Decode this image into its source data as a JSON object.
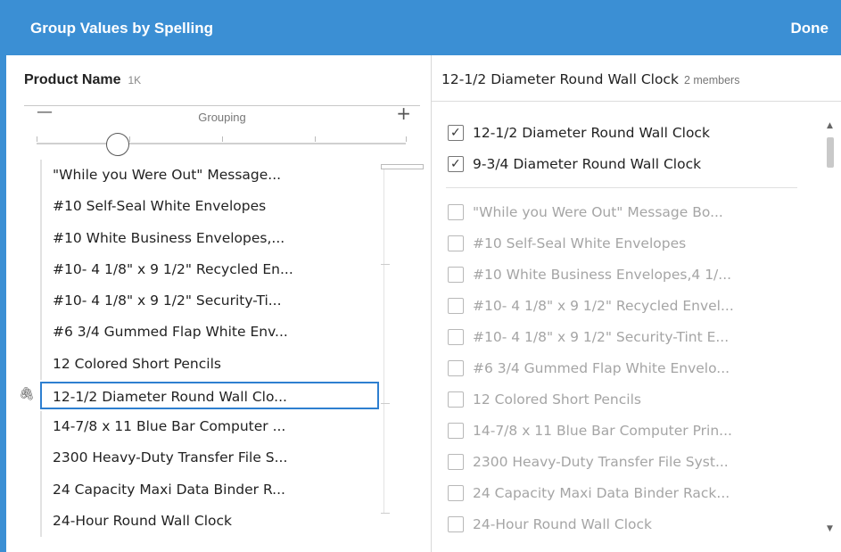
{
  "header": {
    "title": "Group Values by Spelling",
    "done_label": "Done"
  },
  "left": {
    "field_name": "Product Name",
    "field_count": "1K",
    "slider": {
      "label": "Grouping",
      "minus": "—",
      "plus": "+",
      "level": 0.22
    },
    "values": [
      "\"While you Were Out\" Message...",
      "#10 Self-Seal White Envelopes",
      "#10 White Business Envelopes,...",
      "#10- 4 1/8\" x 9 1/2\" Recycled En...",
      "#10- 4 1/8\" x 9 1/2\" Security-Ti...",
      "#6 3/4 Gummed Flap White Env...",
      "12 Colored Short Pencils",
      "12-1/2 Diameter Round Wall Clo...",
      "14-7/8 x 11 Blue Bar Computer ...",
      "2300 Heavy-Duty Transfer File S...",
      "24 Capacity Maxi Data Binder R...",
      "24-Hour Round Wall Clock"
    ],
    "selected_index": 7
  },
  "right": {
    "group_name": "12-1/2 Diameter Round Wall Clock",
    "members_label": "2 members",
    "checked_members": [
      "12-1/2 Diameter Round Wall Clock",
      "9-3/4 Diameter Round Wall Clock"
    ],
    "other_values": [
      "\"While you Were Out\" Message Bo...",
      "#10 Self-Seal White Envelopes",
      "#10 White Business Envelopes,4 1/...",
      "#10- 4 1/8\" x 9 1/2\" Recycled Envel...",
      "#10- 4 1/8\" x 9 1/2\" Security-Tint E...",
      "#6 3/4 Gummed Flap White Envelo...",
      "12 Colored Short Pencils",
      "14-7/8 x 11 Blue Bar Computer Prin...",
      "2300 Heavy-Duty Transfer File Syst...",
      "24 Capacity Maxi Data Binder Rack...",
      "24-Hour Round Wall Clock"
    ]
  },
  "colors": {
    "header": "#3b8fd4",
    "selection": "#2e7fd0"
  },
  "icons": {
    "group": "paperclip-icon",
    "checkbox_checked": "checkmark-icon"
  }
}
